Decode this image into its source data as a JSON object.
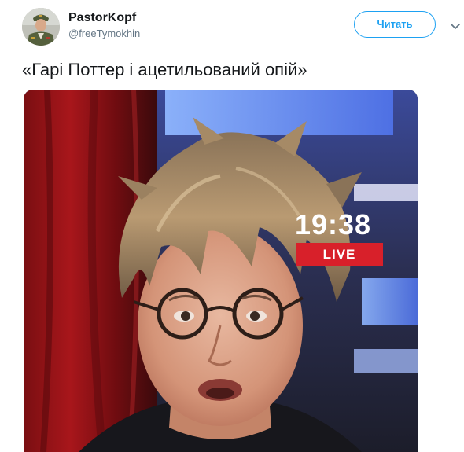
{
  "tweet": {
    "display_name": "PastorKopf",
    "handle": "@freeTymokhin",
    "follow_label": "Читать",
    "text": "«Гарі Поттер і ацетильований опій»"
  },
  "media": {
    "clock": "19:38",
    "live": "LIVE"
  },
  "icons": {
    "menu": "chevron-down-icon",
    "avatar": "avatar"
  },
  "colors": {
    "accent": "#1da1f2",
    "text": "#14171a",
    "secondary": "#657786",
    "live_red": "#d8202a"
  }
}
